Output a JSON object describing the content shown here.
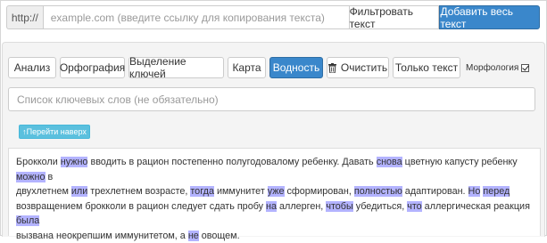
{
  "urlbar": {
    "prefix": "http://",
    "placeholder": "example.com (введите ссылку для копирования текста)",
    "filter_label": "Фильтровать текст",
    "add_all_label": "Добавить весь текст"
  },
  "toolbar": {
    "buttons": [
      {
        "label": "Анализ",
        "active": false
      },
      {
        "label": "Орфография",
        "active": false
      },
      {
        "label": "Выделение ключей",
        "active": false
      },
      {
        "label": "Карта",
        "active": false
      },
      {
        "label": "Водность",
        "active": true
      },
      {
        "label": "Очистить",
        "active": false
      },
      {
        "label": "Только текст",
        "active": false
      }
    ],
    "morphology_label": "Морфология",
    "morphology_checked": true
  },
  "keywords": {
    "placeholder": "Список ключевых слов (не обязательно)"
  },
  "scroll_top_label": "↑Перейти наверх",
  "text": {
    "line1": [
      "Брокколи ",
      "нужно",
      " вводить в рацион постепенно полугодовалому ребенку. Давать ",
      "снова",
      " цветную капусту ребенку ",
      "можно",
      " в"
    ],
    "line2": [
      "двухлетнем ",
      "или",
      " трехлетнем возрасте, ",
      "тогда",
      " иммунитет ",
      "уже",
      " сформирован, ",
      "полностью",
      " адаптирован. ",
      "Но",
      " ",
      "перед"
    ],
    "line3": [
      "возвращением брокколи в рацион следует сдать пробу ",
      "на",
      " аллерген, ",
      "чтобы",
      " убедиться, ",
      "что",
      " аллергическая реакция ",
      "была"
    ],
    "line4": [
      "вызвана неокрепшим иммунитетом, а ",
      "не",
      " овощем."
    ]
  },
  "colors": {
    "primary": "#3a87cb",
    "info": "#5bc0de",
    "highlight": "#b3b3ff",
    "panel_bg": "#f4f4f4"
  }
}
